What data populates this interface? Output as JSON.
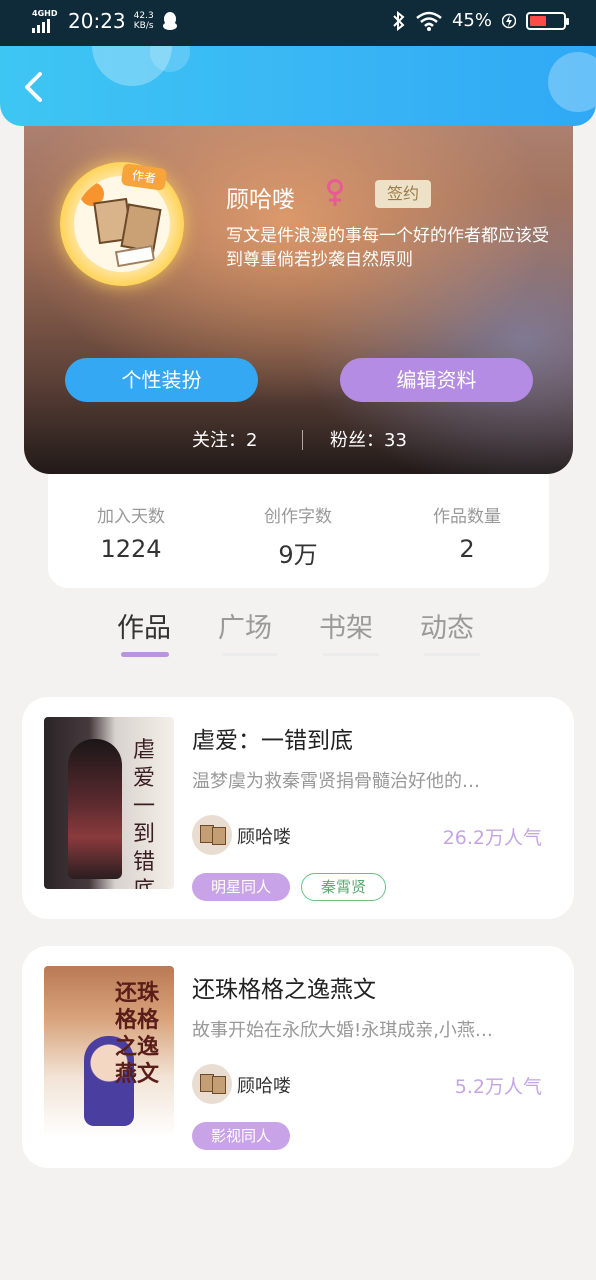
{
  "status_bar": {
    "network": "4GHD",
    "time": "20:23",
    "speed_value": "42.3",
    "speed_unit": "KB/s",
    "battery": "45%"
  },
  "profile": {
    "name": "顾哈喽",
    "badge": "签约",
    "bio": "写文是件浪漫的事每一个好的作者都应该受到尊重倘若抄袭自然原则",
    "avatar_tag": "作者",
    "buttons": {
      "dress_up": "个性装扮",
      "edit": "编辑资料"
    },
    "follow_label": "关注：2",
    "fans_label": "粉丝：33"
  },
  "stats": [
    {
      "label": "加入天数",
      "value": "1224"
    },
    {
      "label": "创作字数",
      "value": "9万"
    },
    {
      "label": "作品数量",
      "value": "2"
    }
  ],
  "tabs": [
    {
      "label": "作品",
      "active": true
    },
    {
      "label": "广场",
      "active": false
    },
    {
      "label": "书架",
      "active": false
    },
    {
      "label": "动态",
      "active": false
    }
  ],
  "works": [
    {
      "title": "虐爱：一错到底",
      "desc": "温梦虞为救秦霄贤捐骨髓治好他的…",
      "author": "顾哈喽",
      "popularity": "26.2万人气",
      "cover_text": "虐爱一到错底",
      "tags": [
        "明星同人",
        "秦霄贤"
      ]
    },
    {
      "title": "还珠格格之逸燕文",
      "desc": "故事开始在永欣大婚!永琪成亲,小燕…",
      "author": "顾哈喽",
      "popularity": "5.2万人气",
      "cover_text": "还珠格格之逸燕文",
      "tags": [
        "影视同人"
      ]
    }
  ],
  "colors": {
    "header": "#38b4f5",
    "accent_blue": "#34a8f3",
    "accent_purple": "#b58ce3",
    "tag_green": "#5aa970"
  }
}
